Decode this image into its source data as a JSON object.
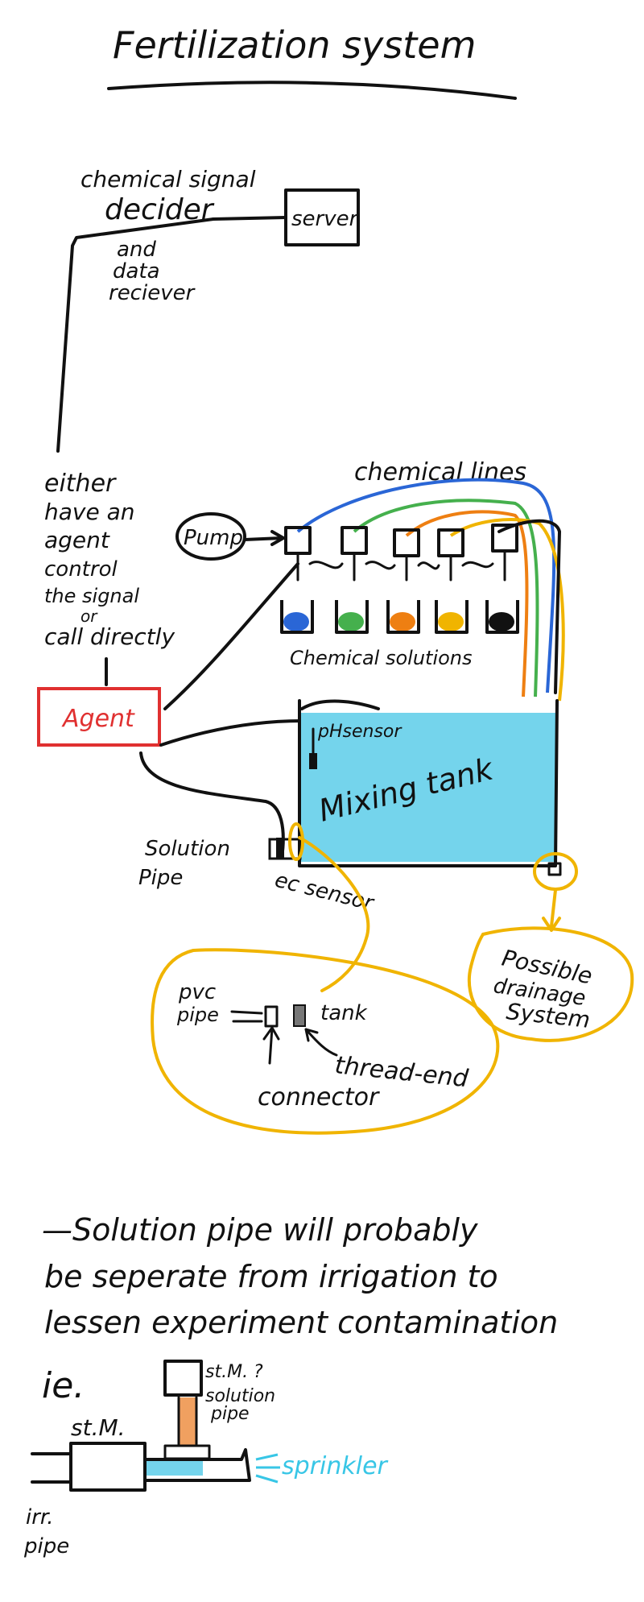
{
  "title": "Fertilization system",
  "labels": {
    "decider_line1": "chemical signal",
    "decider_line2": "decider",
    "decider_line3": "and",
    "decider_line4": "data",
    "decider_line5": "reciever",
    "server": "server",
    "agent_note": [
      "either",
      "have an",
      "agent",
      "control",
      "the signal",
      "or",
      "call directly"
    ],
    "chemical_lines": "chemical lines",
    "pump": "Pump",
    "chemical_solutions": "Chemical solutions",
    "agent": "Agent",
    "ph_sensor": "pHsensor",
    "mixing_tank": "Mixing tank",
    "solution_pipe": [
      "Solution",
      "Pipe"
    ],
    "ec_sensor": "ec sensor",
    "pvc_pipe": [
      "pvc",
      "pipe"
    ],
    "tank": "tank",
    "thread_end": "thread-end",
    "connector": "connector",
    "drainage": [
      "Possible",
      "drainage",
      "System"
    ],
    "note_lines": [
      "—Solution pipe will probably",
      "be seperate from irrigation to",
      "lessen experiment contamination"
    ],
    "ie": "ie.",
    "stm_q": "st.M. ?",
    "solution_pipe_small": [
      "solution",
      "pipe"
    ],
    "stm": "st.M.",
    "sprinkler": "sprinkler",
    "irr_pipe": [
      "irr.",
      "pipe"
    ]
  },
  "colors": {
    "agent_red": "#e03030",
    "tank_blue": "#74d4ec",
    "line_blue": "#2a66d6",
    "line_green": "#45b04d",
    "line_orange": "#ee7f12",
    "line_yellow": "#f0b400",
    "sprinkler_cyan": "#38c6e6",
    "pipe_orange": "#f0a060"
  },
  "solutions": [
    {
      "color": "#2a66d6"
    },
    {
      "color": "#45b04d"
    },
    {
      "color": "#ee7f12"
    },
    {
      "color": "#f0b400"
    },
    {
      "color": "#111111"
    }
  ]
}
